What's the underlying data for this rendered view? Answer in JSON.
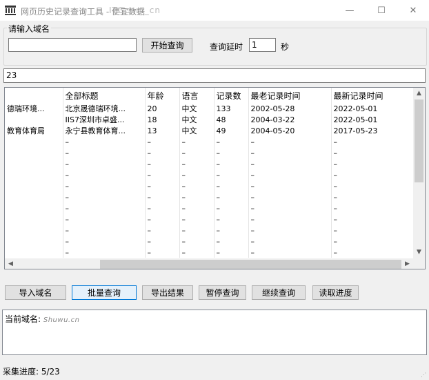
{
  "window": {
    "title": "网页历史记录查询工具 - 便宜数据",
    "title_overlay": "ITGcom_cn",
    "minimize_symbol": "—",
    "maximize_symbol": "☐",
    "close_symbol": "✕",
    "app_icon": "bank-building-icon"
  },
  "query_group": {
    "title": "请输入域名",
    "domain_value": "",
    "start_button": "开始查询",
    "delay_label": "查询延时",
    "delay_value": "1",
    "delay_unit": "秒"
  },
  "filter_value": "23",
  "grid": {
    "headers": [
      "",
      "全部标题",
      "年龄",
      "语言",
      "记录数",
      "最老记录时间",
      "最新记录时间"
    ],
    "rows": [
      [
        "德瑞环境...",
        "北京晟德瑞环境...",
        "20",
        "中文",
        "133",
        "2002-05-28",
        "2022-05-01"
      ],
      [
        "",
        "IIS7深圳市卓盛...",
        "18",
        "中文",
        "48",
        "2004-03-22",
        "2022-05-01"
      ],
      [
        "教育体育局",
        "永宁县教育体育...",
        "13",
        "中文",
        "49",
        "2004-05-20",
        "2017-05-23"
      ],
      [
        "",
        "–",
        "–",
        "–",
        "–",
        "–",
        "–"
      ],
      [
        "",
        "–",
        "–",
        "–",
        "–",
        "–",
        "–"
      ],
      [
        "",
        "–",
        "–",
        "–",
        "–",
        "–",
        "–"
      ],
      [
        "",
        "–",
        "–",
        "–",
        "–",
        "–",
        "–"
      ],
      [
        "",
        "–",
        "–",
        "–",
        "–",
        "–",
        "–"
      ],
      [
        "",
        "–",
        "–",
        "–",
        "–",
        "–",
        "–"
      ],
      [
        "",
        "–",
        "–",
        "–",
        "–",
        "–",
        "–"
      ],
      [
        "",
        "–",
        "–",
        "–",
        "–",
        "–",
        "–"
      ],
      [
        "",
        "–",
        "–",
        "–",
        "–",
        "–",
        "–"
      ],
      [
        "",
        "–",
        "–",
        "–",
        "–",
        "–",
        "–"
      ],
      [
        "",
        "–",
        "–",
        "–",
        "–",
        "–",
        "–"
      ]
    ]
  },
  "buttons": {
    "import": "导入域名",
    "batch": "批量查询",
    "export": "导出结果",
    "pause": "暂停查询",
    "continue": "继续查询",
    "progress": "读取进度"
  },
  "log": {
    "label": "当前域名:",
    "domain": "Shuwu.cn"
  },
  "status": {
    "text": "采集进度: 5/23"
  }
}
